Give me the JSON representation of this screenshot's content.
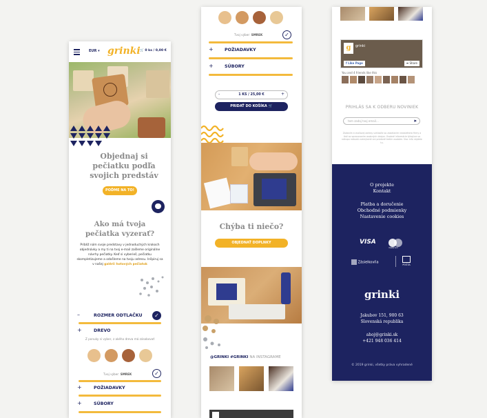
{
  "colors": {
    "navy": "#1d2360",
    "yellow": "#f2b227",
    "bg": "#f3f3f1"
  },
  "screen1": {
    "currency": "EUR",
    "logo": "grinki",
    "cart": "0 ks / 0,00 €",
    "hero_title": "Objednaj si pečiatku podľa svojich predstáv",
    "hero_button": "POĎME NA TO!",
    "section_title": "Ako má tvoja pečiatka vyzerať?",
    "intro_text": "Priblíž nám svoje predstavy v jednoduchých krokoch objednávky a my ti na tvoj e-mail zašleme originálne návrhy pečiatky. Keď si vyberieš, pečiatku skompletizujeme a odošleme na tvoju adresu. Inšpiruj sa v našej",
    "intro_link": "galérii hotových pečiatok",
    "rozmer": "ROZMER ODTLAČKU",
    "drevo": "DREVO",
    "drevo_hint": "Z ponuky si vyber, z akého dreva má zásobovať",
    "selection_label": "Tvoj výber:",
    "selection_value": "SMREK",
    "poziadavky": "POŽIADAVKY",
    "subory": "SÚBORY"
  },
  "screen2": {
    "selection_label": "Tvoj výber:",
    "selection_value": "SMREK",
    "poziadavky": "POŽIADAVKY",
    "subory": "SÚBORY",
    "quantity": "1 KS / 25,00 €",
    "qty_minus": "-",
    "qty_plus": "+",
    "add_to_cart": "PRIDAŤ DO KOŠÍKA",
    "missing_title": "Chýba ti niečo?",
    "missing_button": "OBJEDNAŤ DOPLNKY",
    "instagram_tag": "@GRINKI  #GRINKI",
    "instagram_suffix": "NA INSTAGRAME"
  },
  "screen3": {
    "fb_page": "grinki",
    "fb_like": "Like Page",
    "fb_share": "Share",
    "fb_friends": "You and 4 friends like this",
    "newsletter_title": "PRIHLÁS SA K ODBERU NOVINIEK",
    "newsletter_placeholder": "tem zadaj tvoj email...",
    "newsletter_note": "Zadaním e-mailovej adresy súhlasíte so zasielaním newslettera firmy a tiež so spracovaním osobných údajov. Osobné informácie týkajúce sa nákupu nebudú zverejnené ani predané tretím osobám. Viac info nájdete tu.",
    "footer_links": [
      "O projekte",
      "Kontakt",
      "Platba a doručenie",
      "Obchodné podmienky",
      "Nastavenie cookies"
    ],
    "payment_visa": "VISA",
    "payment_mc": "mastercard",
    "shipping_1": "Zásielkovňa",
    "shipping_2": "POŠTA",
    "footer_logo": "grinki",
    "address_1": "Jakubov 151, 900 63",
    "address_2": "Slovenská republika",
    "email": "ahoj@grinki.sk",
    "phone": "+421 948 036 414",
    "copyright": "© 2019 grinki, všetky práva vyhradené"
  }
}
